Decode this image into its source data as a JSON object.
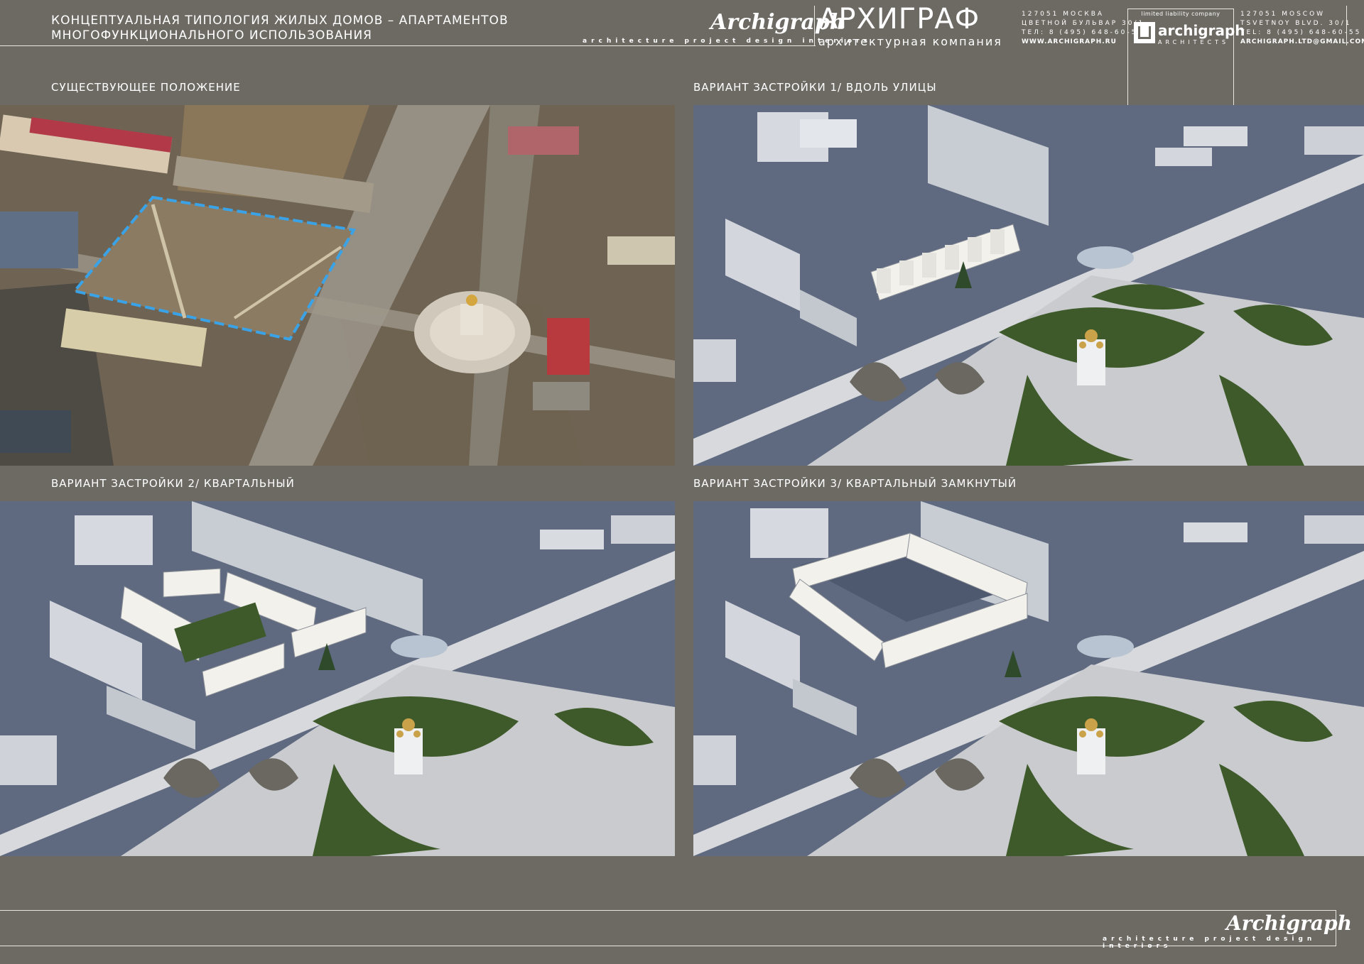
{
  "header": {
    "title_line1": "КОНЦЕПТУАЛЬНАЯ ТИПОЛОГИЯ ЖИЛЫХ ДОМОВ – АПАРТАМЕНТОВ",
    "title_line2": "МНОГОФУНКЦИОНАЛЬНОГО ИСПОЛЬЗОВАНИЯ",
    "logo_script": "Archigraph",
    "tagline": "architecture project design interiors",
    "brand_name": "АРХИГРАФ",
    "brand_sub": "архитектурная компания",
    "ru_address": [
      "127051 МОСКВА",
      "ЦВЕТНОЙ БУЛЬВАР 30/1",
      "ТЕЛ: 8 (495) 648-60-55",
      "WWW.ARCHIGRAPH.RU"
    ],
    "en_address": [
      "127051 MOSCOW",
      "TSVETNOY BLVD. 30/1",
      "TEL: 8 (495) 648-60-55",
      "ARCHIGRAPH.LTD@GMAIL.COM"
    ],
    "logo_box": {
      "llc": "limited liability company",
      "name": "archigraph",
      "sub": "ARCHITECTS"
    }
  },
  "panels": [
    {
      "caption": "СУЩЕСТВУЮЩЕЕ ПОЛОЖЕНИЕ"
    },
    {
      "caption": "ВАРИАНТ ЗАСТРОЙКИ 1/ ВДОЛЬ УЛИЦЫ"
    },
    {
      "caption": "ВАРИАНТ ЗАСТРОЙКИ 2/ КВАРТАЛЬНЫЙ"
    },
    {
      "caption": "ВАРИАНТ ЗАСТРОЙКИ 3/ КВАРТАЛЬНЫЙ ЗАМКНУТЫЙ"
    }
  ],
  "footer": {
    "logo_script": "Archigraph",
    "tagline": "architecture project design interiors"
  },
  "colors": {
    "background": "#6d6a64",
    "render_ground": "#5f6a80",
    "plaza": "#c9cbcf",
    "lawn": "#3e5a2a",
    "site_outline": "#3aa3e8"
  }
}
